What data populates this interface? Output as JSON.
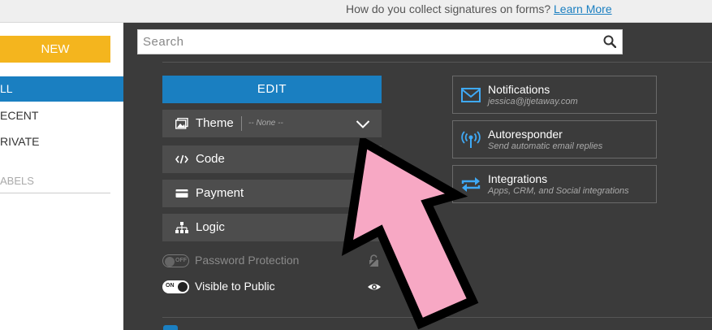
{
  "topbar": {
    "message": "How do you collect signatures on forms?",
    "link": "Learn More"
  },
  "sidebar": {
    "new_label": "NEW",
    "items": [
      {
        "label": "LL",
        "active": true
      },
      {
        "label": "ECENT",
        "active": false
      },
      {
        "label": "RIVATE",
        "active": false
      }
    ],
    "labels_heading": "ABELS"
  },
  "search": {
    "placeholder": "Search",
    "icon": "search-icon"
  },
  "editor": {
    "edit_label": "EDIT",
    "options": [
      {
        "label": "Theme",
        "icon": "theme-icon",
        "value": "-- None --"
      },
      {
        "label": "Code",
        "icon": "code-icon"
      },
      {
        "label": "Payment",
        "icon": "credit-card-icon"
      },
      {
        "label": "Logic",
        "icon": "logic-tree-icon"
      }
    ],
    "toggles": [
      {
        "label": "Password Protection",
        "state": "OFF",
        "icon": "lock-icon"
      },
      {
        "label": "Visible to Public",
        "state": "ON",
        "icon": "eye-icon"
      }
    ]
  },
  "cards": [
    {
      "title": "Notifications",
      "subtitle": "jessica@jtjetaway.com",
      "icon": "envelope-icon"
    },
    {
      "title": "Autoresponder",
      "subtitle": "Send automatic email replies",
      "icon": "broadcast-icon"
    },
    {
      "title": "Integrations",
      "subtitle": "Apps, CRM, and Social integrations",
      "icon": "sync-arrows-icon"
    }
  ],
  "colors": {
    "accent": "#1a7fc1",
    "new_button": "#f4b51e",
    "background": "#3b3b3b",
    "annotation_arrow": "#f7a8c4"
  }
}
